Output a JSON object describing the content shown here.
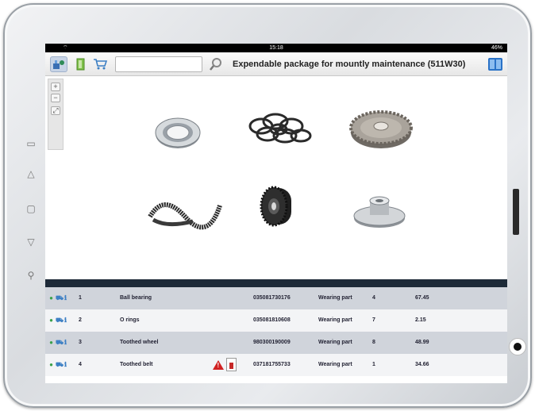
{
  "status_bar": {
    "time": "15:18",
    "battery": "46%"
  },
  "toolbar": {
    "search": {
      "value": "",
      "placeholder": ""
    },
    "title": "Expendable package for mountly maintenance (511W30)"
  },
  "zoom": {
    "plus": "+",
    "minus": "−"
  },
  "parts": [
    {
      "name": "Ball bearing"
    },
    {
      "name": "O rings"
    },
    {
      "name": "Toothed wheel"
    },
    {
      "name": "Toothed belt"
    },
    {
      "name": "Toothed pulley"
    },
    {
      "name": "Flange hub"
    }
  ],
  "table": {
    "rows": [
      {
        "pos": "1",
        "name": "Ball bearing",
        "number": "035081730176",
        "category": "Wearing part",
        "qty": "4",
        "price": "67.45",
        "warning": false
      },
      {
        "pos": "2",
        "name": "O rings",
        "number": "035081810608",
        "category": "Wearing part",
        "qty": "7",
        "price": "2.15",
        "warning": false
      },
      {
        "pos": "3",
        "name": "Toothed wheel",
        "number": "980300190009",
        "category": "Wearing part",
        "qty": "8",
        "price": "48.99",
        "warning": false
      },
      {
        "pos": "4",
        "name": "Toothed belt",
        "number": "037181755733",
        "category": "Wearing part",
        "qty": "1",
        "price": "34.66",
        "warning": true
      }
    ]
  },
  "colors": {
    "separator": "#1d2a38",
    "row_shade": "#d0d4db",
    "accent": "#2a72c7"
  }
}
